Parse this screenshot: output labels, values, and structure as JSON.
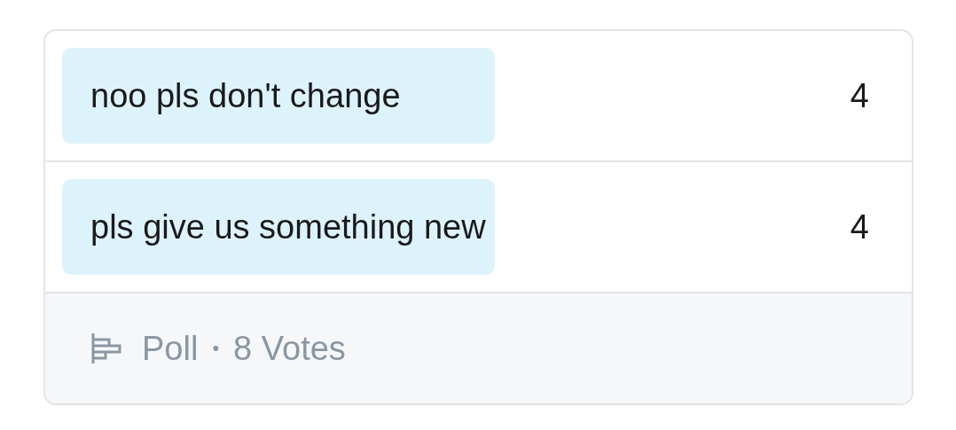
{
  "poll": {
    "options": [
      {
        "label": "noo pls don't change",
        "count": "4"
      },
      {
        "label": "pls give us something new",
        "count": "4"
      }
    ],
    "footer": {
      "type_label": "Poll",
      "separator": "•",
      "votes": "8 Votes"
    }
  }
}
